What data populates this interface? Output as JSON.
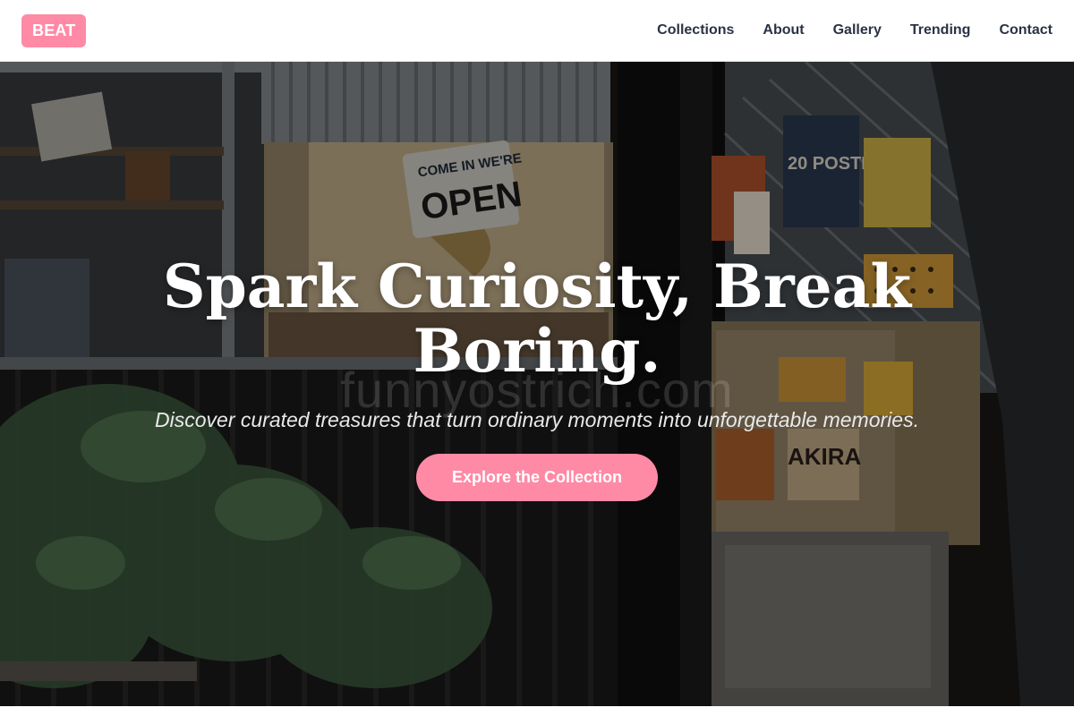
{
  "header": {
    "logo": "BEAT",
    "nav": [
      {
        "label": "Collections"
      },
      {
        "label": "About"
      },
      {
        "label": "Gallery"
      },
      {
        "label": "Trending"
      },
      {
        "label": "Contact"
      }
    ]
  },
  "hero": {
    "title": "Spark Curiosity, Break Boring.",
    "subtitle": "Discover curated treasures that turn ordinary moments into unforgettable memories.",
    "cta_label": "Explore the Collection",
    "watermark": "funnyostrich.com",
    "sign_line1": "COME IN WE'RE",
    "sign_line2": "OPEN",
    "poster_text": "20 POSTERS",
    "book_text": "AKIRA"
  },
  "colors": {
    "accent": "#ff8aa6",
    "nav_text": "#2a3344",
    "hero_overlay": "rgba(0,0,0,0.38)"
  }
}
